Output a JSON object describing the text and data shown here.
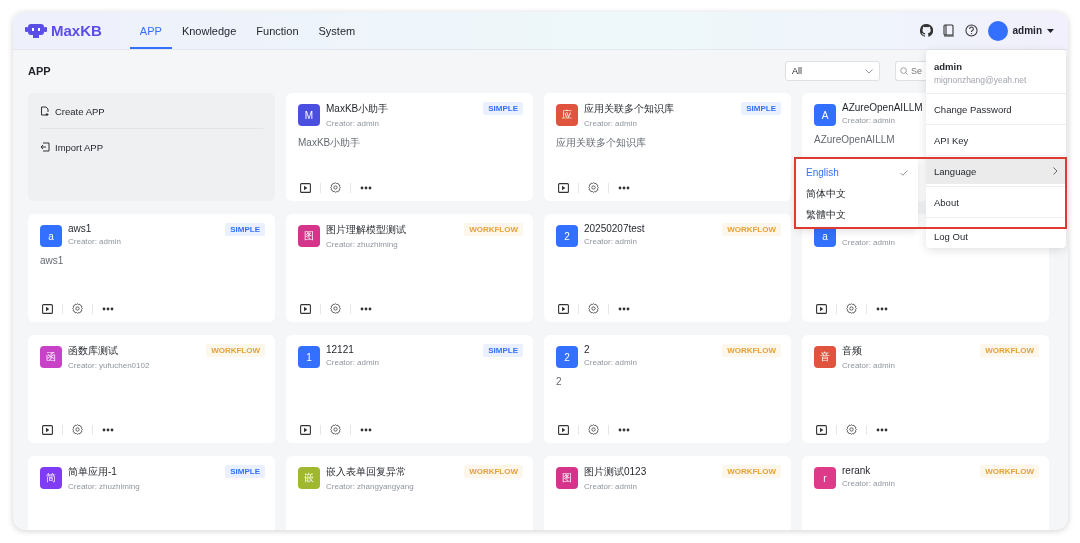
{
  "header": {
    "logo": "MaxKB",
    "tabs": [
      {
        "label": "APP",
        "selected": true
      },
      {
        "label": "Knowledge",
        "selected": false
      },
      {
        "label": "Function",
        "selected": false
      },
      {
        "label": "System",
        "selected": false
      }
    ],
    "user": "admin"
  },
  "page": {
    "title": "APP",
    "filter": {
      "value": "All"
    },
    "search": {
      "placeholder": "Se"
    }
  },
  "create_card": [
    {
      "label": "Create APP",
      "kind": "create"
    },
    {
      "label": "Import APP",
      "kind": "import"
    }
  ],
  "apps": [
    {
      "avatar": "M",
      "color": "#4b4fe0",
      "name": "MaxKB小助手",
      "creator": "Creator: admin",
      "tag": {
        "label": "SIMPLE",
        "color": "#3370ff"
      },
      "description": "MaxKB小助手",
      "actions": true
    },
    {
      "avatar": "应",
      "color": "#e0533f",
      "name": "应用关联多个知识库",
      "creator": "Creator: admin",
      "tag": {
        "label": "SIMPLE",
        "color": "#3370ff"
      },
      "description": "应用关联多个知识库",
      "actions": true
    },
    {
      "avatar": "A",
      "color": "#3370ff",
      "name": "AZureOpenAILLM",
      "creator": "Creator: admin",
      "description": "AZureOpenAILLM",
      "actions": false
    },
    {
      "avatar": "a",
      "color": "#3370ff",
      "name": "aws1",
      "creator": "Creator: admin",
      "tag": {
        "label": "SIMPLE",
        "color": "#3370ff"
      },
      "description": "aws1",
      "actions": true
    },
    {
      "avatar": "图",
      "color": "#d6338a",
      "name": "图片理解模型测试",
      "creator": "Creator: zhuzhiming",
      "tag": {
        "label": "WORKFLOW",
        "color": "#e5a23a"
      },
      "actions": true
    },
    {
      "avatar": "2",
      "color": "#3370ff",
      "name": "20250207test",
      "creator": "Creator: admin",
      "tag": {
        "label": "WORKFLOW",
        "color": "#e5a23a"
      },
      "actions": true
    },
    {
      "avatar": "a",
      "color": "#3370ff",
      "creator": "Creator: admin",
      "actions": true
    },
    {
      "avatar": "函",
      "color": "#c742c7",
      "name": "函数库测试",
      "creator": "Creator: yufuchen0102",
      "tag": {
        "label": "WORKFLOW",
        "color": "#e5a23a"
      },
      "actions": true
    },
    {
      "avatar": "1",
      "color": "#3370ff",
      "name": "12121",
      "creator": "Creator: admin",
      "tag": {
        "label": "SIMPLE",
        "color": "#3370ff"
      },
      "actions": true
    },
    {
      "avatar": "2",
      "color": "#3370ff",
      "name": "2",
      "creator": "Creator: admin",
      "tag": {
        "label": "WORKFLOW",
        "color": "#e5a23a"
      },
      "description": "2",
      "actions": true
    },
    {
      "avatar": "音",
      "color": "#e0533f",
      "name": "音频",
      "creator": "Creator: admin",
      "tag": {
        "label": "WORKFLOW",
        "color": "#e5a23a"
      },
      "actions": true
    },
    {
      "avatar": "简",
      "color": "#7f3bf5",
      "name": "简单应用-1",
      "creator": "Creator: zhuzhiming",
      "tag": {
        "label": "SIMPLE",
        "color": "#3370ff"
      },
      "actions": false
    },
    {
      "avatar": "嵌",
      "color": "#a0b82f",
      "name": "嵌入表单回复异常",
      "creator": "Creator: zhangyangyang",
      "tag": {
        "label": "WORKFLOW",
        "color": "#e5a23a"
      },
      "actions": false
    },
    {
      "avatar": "图",
      "color": "#d6338a",
      "name": "图片测试0123",
      "creator": "Creator: admin",
      "tag": {
        "label": "WORKFLOW",
        "color": "#e5a23a"
      },
      "actions": false
    },
    {
      "avatar": "r",
      "color": "#de3a8a",
      "name": "rerank",
      "creator": "Creator: admin",
      "tag": {
        "label": "WORKFLOW",
        "color": "#e5a23a"
      },
      "actions": false
    }
  ],
  "user_menu": {
    "name": "admin",
    "email": "mignonzhang@yeah.net",
    "items": [
      {
        "label": "Change Password",
        "expanded": false,
        "has_submenu": false
      },
      {
        "label": "API Key",
        "expanded": false,
        "has_submenu": false
      },
      {
        "label": "Language",
        "expanded": true,
        "has_submenu": true
      },
      {
        "label": "About",
        "expanded": false,
        "has_submenu": false
      },
      {
        "label": "Log Out",
        "expanded": false,
        "has_submenu": false
      }
    ]
  },
  "language_menu": [
    {
      "label": "English",
      "selected": true
    },
    {
      "label": "简体中文",
      "selected": false
    },
    {
      "label": "繁體中文",
      "selected": false
    }
  ]
}
